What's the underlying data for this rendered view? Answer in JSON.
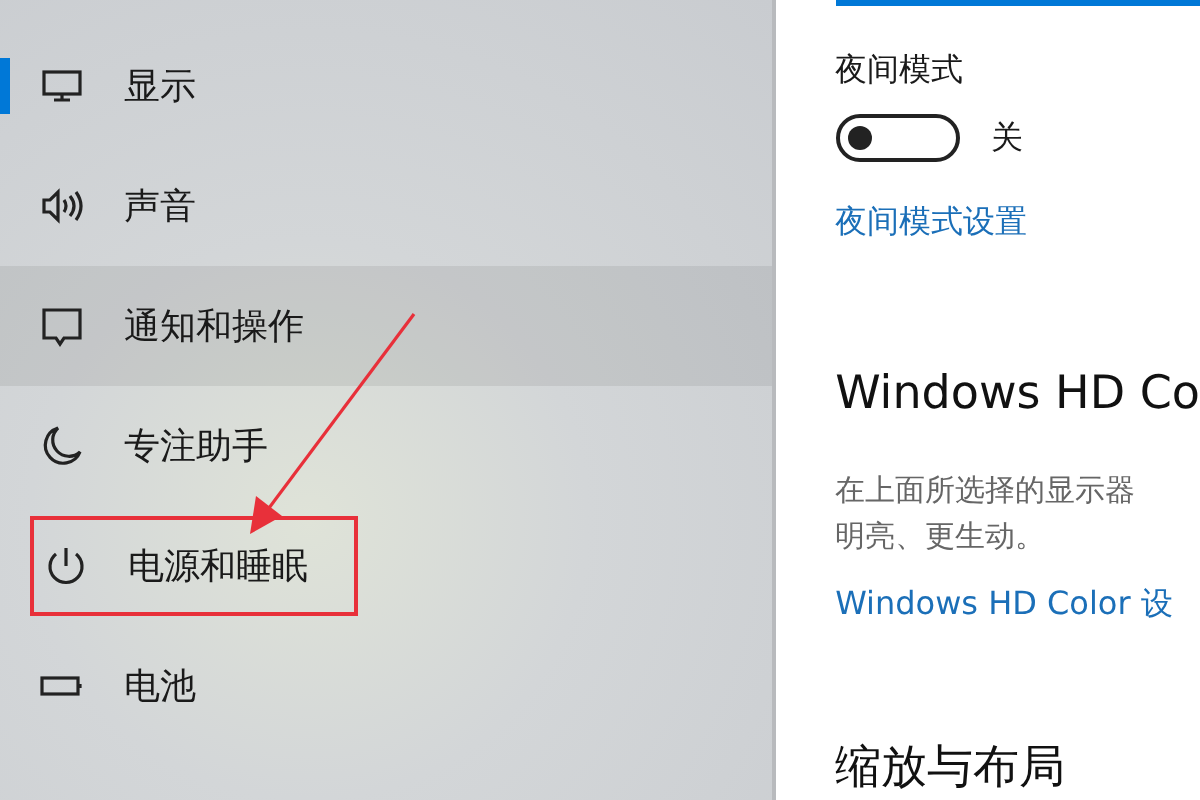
{
  "sidebar": {
    "items": [
      {
        "label": "显示",
        "selected": true,
        "hovered": false,
        "annotated": false
      },
      {
        "label": "声音",
        "selected": false,
        "hovered": false,
        "annotated": false
      },
      {
        "label": "通知和操作",
        "selected": false,
        "hovered": true,
        "annotated": false
      },
      {
        "label": "专注助手",
        "selected": false,
        "hovered": false,
        "annotated": false
      },
      {
        "label": "电源和睡眠",
        "selected": false,
        "hovered": false,
        "annotated": true
      },
      {
        "label": "电池",
        "selected": false,
        "hovered": false,
        "annotated": false
      }
    ]
  },
  "content": {
    "night_mode": {
      "title": "夜间模式",
      "on": false,
      "state_label": "关",
      "link": "夜间模式设置"
    },
    "hd_color": {
      "heading": "Windows HD Co",
      "description": [
        "在上面所选择的显示器",
        "明亮、更生动。"
      ],
      "link": "Windows HD Color 设"
    },
    "scale_heading": "缩放与布局"
  }
}
